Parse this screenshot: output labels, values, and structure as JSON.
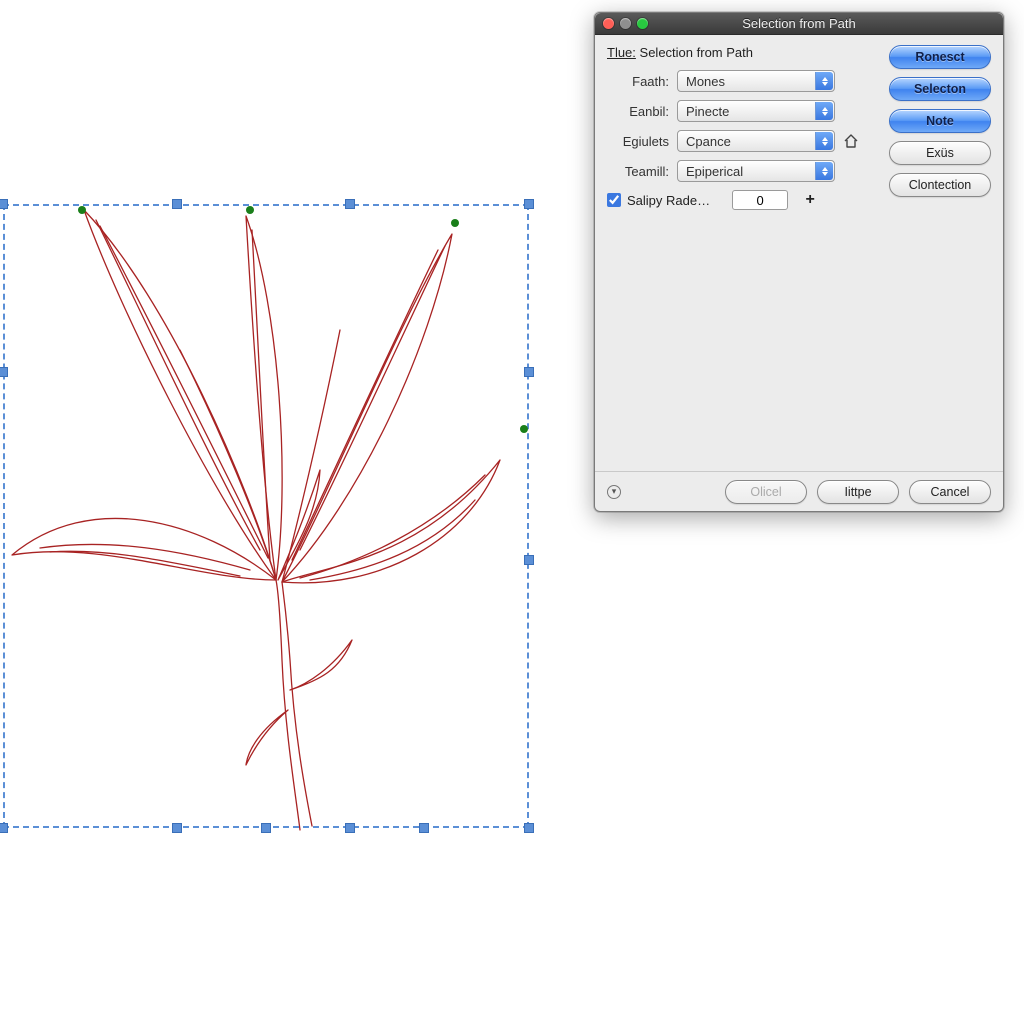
{
  "dialog": {
    "title": "Selection from Path",
    "subheaderLabel": "Tlue:",
    "subheaderValue": "Selection from Path",
    "fields": [
      {
        "label": "Faath:",
        "value": "Mones"
      },
      {
        "label": "Eanbil:",
        "value": "Pinecte"
      },
      {
        "label": "Egiulets",
        "value": "Cpance"
      },
      {
        "label": "Teamill:",
        "value": "Epiperical"
      }
    ],
    "checkbox": {
      "label": "Salipy Rade…",
      "checked": true
    },
    "numberValue": "0",
    "rightButtons": [
      {
        "label": "Ronesct",
        "style": "blue"
      },
      {
        "label": "Selecton",
        "style": "blue"
      },
      {
        "label": "Note",
        "style": "blue"
      },
      {
        "label": "Exüs",
        "style": "plain"
      },
      {
        "label": "Clontection",
        "style": "plain"
      }
    ],
    "footer": {
      "disabled": "Olicel",
      "primary": "Iittpe",
      "cancel": "Cancel"
    }
  }
}
